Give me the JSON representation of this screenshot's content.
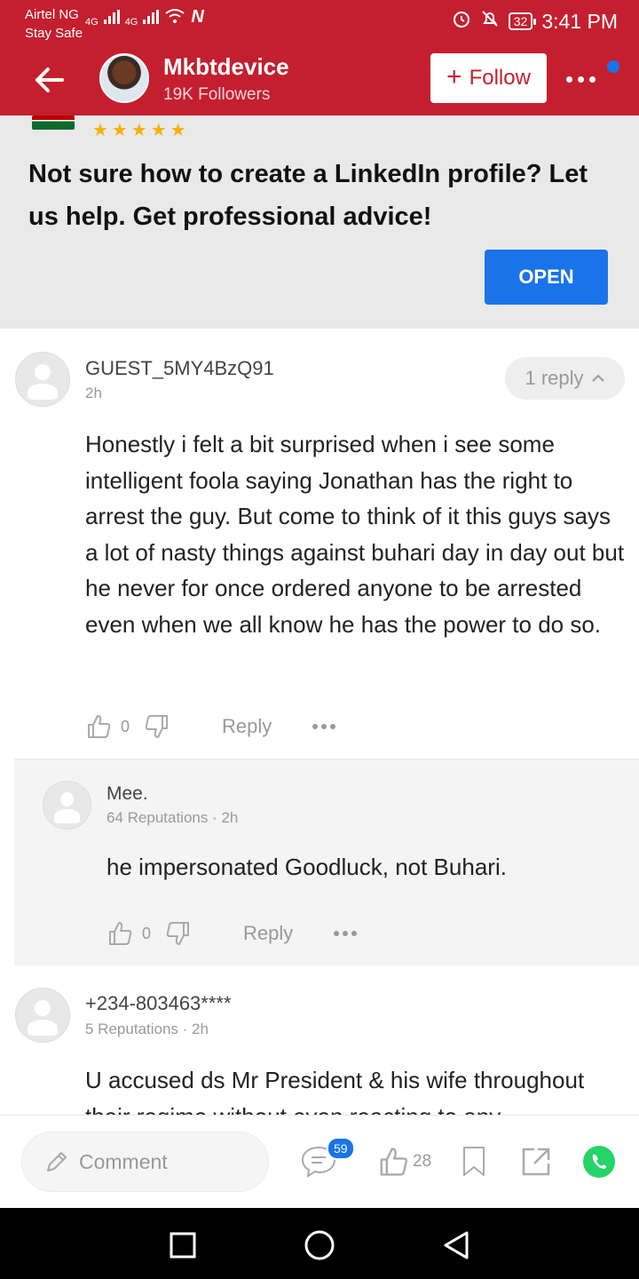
{
  "status_bar": {
    "carrier": "Airtel NG",
    "carrier_sub": "Stay Safe",
    "network_1": "4G",
    "network_2": "4G",
    "battery": "32",
    "time": "3:41 PM"
  },
  "header": {
    "channel_name": "Mkbtdevice",
    "followers": "19K Followers",
    "follow_label": "Follow",
    "accent_color": "#c41f2f"
  },
  "ad": {
    "text": "Not sure how to create a LinkedIn profile? Let us help. Get professional advice!",
    "rating_stars": "★★★★★",
    "open_label": "OPEN"
  },
  "comments": [
    {
      "author": "GUEST_5MY4BzQ91",
      "meta": "2h",
      "reply_pill": "1 reply",
      "text": "Honestly i felt a bit surprised when i see some intelligent foola saying Jonathan has the right to arrest the guy. But come to think of it  this guys says a lot of nasty things against buhari day in day out but he never for once ordered anyone to be arrested even when we all know he has the power to do so.",
      "likes": "0",
      "reply_label": "Reply",
      "replies": [
        {
          "author": "Mee.",
          "meta": "64 Reputations · 2h",
          "text": "he impersonated Goodluck, not Buhari.",
          "likes": "0",
          "reply_label": "Reply"
        }
      ]
    },
    {
      "author": "+234-803463****",
      "meta": "5 Reputations · 2h",
      "text": "U accused ds Mr President & his wife throughout their regime without even reacting to any"
    }
  ],
  "bottom_bar": {
    "comment_placeholder": "Comment",
    "comment_count": "59",
    "like_count": "28"
  }
}
